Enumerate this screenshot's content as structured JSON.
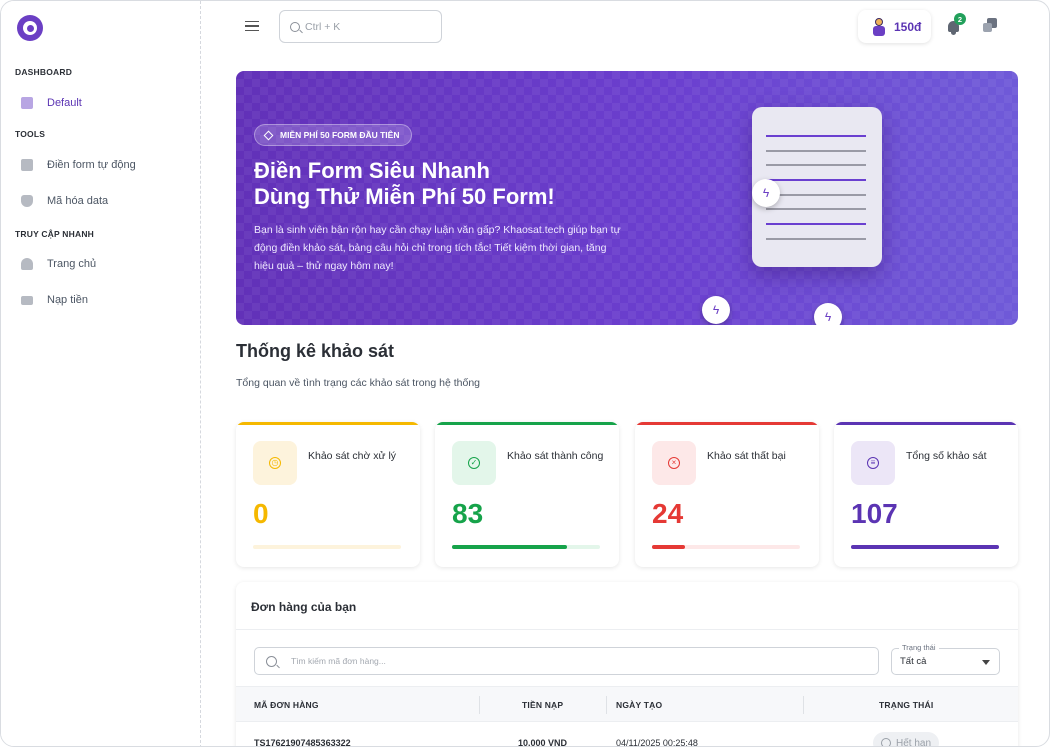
{
  "sidebar": {
    "sections": [
      {
        "label": "DASHBOARD",
        "items": [
          {
            "label": "Default",
            "icon": "document-icon",
            "active": true
          }
        ]
      },
      {
        "label": "TOOLS",
        "items": [
          {
            "label": "Điền form tự động",
            "icon": "form-icon"
          },
          {
            "label": "Mã hóa data",
            "icon": "shield-icon"
          }
        ]
      },
      {
        "label": "TRUY CẬP NHANH",
        "items": [
          {
            "label": "Trang chủ",
            "icon": "home-icon"
          },
          {
            "label": "Nạp tiền",
            "icon": "wallet-icon"
          }
        ]
      }
    ]
  },
  "header": {
    "search_placeholder": "Ctrl + K",
    "balance": "150đ",
    "notification_count": "2"
  },
  "banner": {
    "pill": "MIỄN PHÍ 50 FORM ĐẦU TIÊN",
    "title_line1": "Điền Form Siêu Nhanh",
    "title_line2": "Dùng Thử Miễn Phí 50 Form!",
    "description": "Bạn là sinh viên bận rộn hay cần chạy luận văn gấp? Khaosat.tech giúp bạn tự động điền khảo sát, bảng câu hỏi chỉ trong tích tắc! Tiết kiệm thời gian, tăng hiệu quả – thử ngay hôm nay!"
  },
  "stats": {
    "title": "Thống kê khảo sát",
    "subtitle": "Tổng quan về tình trạng các khảo sát trong hệ thống",
    "cards": [
      {
        "label": "Khảo sát chờ xử lý",
        "value": "0",
        "color": "#f5b800",
        "icon_bg": "#fdf3dc",
        "track": "#fdf3dc",
        "fill": 0,
        "icon": "clock-icon",
        "glyph": "◷"
      },
      {
        "label": "Khảo sát thành công",
        "value": "83",
        "color": "#16a34a",
        "icon_bg": "#e3f6ea",
        "track": "#e3f6ea",
        "fill": 0.78,
        "icon": "check-circle-icon",
        "glyph": "✓"
      },
      {
        "label": "Khảo sát thất bại",
        "value": "24",
        "color": "#e53935",
        "icon_bg": "#fde8e8",
        "track": "#fde8e8",
        "fill": 0.22,
        "icon": "x-circle-icon",
        "glyph": "×"
      },
      {
        "label": "Tổng số khảo sát",
        "value": "107",
        "color": "#5b34b3",
        "icon_bg": "#ece6f7",
        "track": "#ece6f7",
        "fill": 1,
        "icon": "survey-doc-icon",
        "glyph": "≡"
      }
    ]
  },
  "orders": {
    "title": "Đơn hàng của bạn",
    "search_placeholder": "Tìm kiếm mã đơn hàng...",
    "status_filter": {
      "legend": "Trạng thái",
      "value": "Tất cả"
    },
    "columns": [
      "MÃ ĐƠN HÀNG",
      "TIỀN NẠP",
      "NGÀY TẠO",
      "TRẠNG THÁI"
    ],
    "rows": [
      {
        "id": "TS17621907485363322",
        "amount": "10.000 VND",
        "created": "04/11/2025 00:25:48",
        "status": "Hết hạn"
      }
    ]
  },
  "colors": {
    "brand": "#5b34b3",
    "banner_start": "#6231b8",
    "banner_end": "#6f5ad8"
  }
}
